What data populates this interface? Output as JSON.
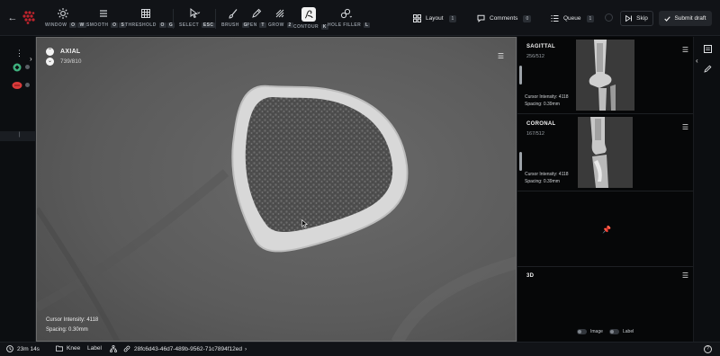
{
  "toolbar": {
    "tools": [
      {
        "name": "window",
        "label": "WINDOW",
        "keys": [
          "O",
          "W"
        ]
      },
      {
        "name": "smooth",
        "label": "SMOOTH",
        "keys": [
          "O",
          "S"
        ]
      },
      {
        "name": "threshold",
        "label": "THRESHOLD",
        "keys": [
          "O",
          "G"
        ]
      },
      {
        "name": "select",
        "label": "SELECT",
        "keys": [
          "ESC"
        ]
      },
      {
        "name": "brush",
        "label": "BRUSH",
        "keys": [
          "G"
        ]
      },
      {
        "name": "pen",
        "label": "PEN",
        "keys": [
          "T"
        ]
      },
      {
        "name": "grow",
        "label": "GROW",
        "keys": [
          "2"
        ]
      },
      {
        "name": "contour",
        "label": "CONTOUR",
        "keys": [
          "K"
        ]
      },
      {
        "name": "hole-filler",
        "label": "HOLE FILLER",
        "keys": [
          "L"
        ]
      }
    ],
    "layout": {
      "label": "Layout",
      "count": "1"
    },
    "comments": {
      "label": "Comments",
      "count": "0"
    },
    "queue": {
      "label": "Queue",
      "count": "1"
    },
    "skip_label": "Skip",
    "submit_label": "Submit draft"
  },
  "axial": {
    "title": "AXIAL",
    "slice": "739/810",
    "cursor_intensity": "Cursor Intensity: 4118",
    "spacing": "Spacing: 0.30mm"
  },
  "sagittal": {
    "title": "SAGITTAL",
    "slice": "256/512",
    "cursor_intensity": "Cursor Intensity: 4118",
    "spacing": "Spacing: 0.39mm"
  },
  "coronal": {
    "title": "CORONAL",
    "slice": "167/512",
    "cursor_intensity": "Cursor Intensity: 4118",
    "spacing": "Spacing: 0.39mm"
  },
  "three_d": {
    "title": "3D",
    "image_toggle": "Image",
    "label_toggle": "Label"
  },
  "bottom": {
    "timer": "23m 14s",
    "body_part": "Knee",
    "label": "Label",
    "series_id": "28fc6d43-46d7-489b-9562-71c7894f12ed"
  },
  "colors": {
    "accent_green": "#3fb27f",
    "accent_red": "#d93a3a",
    "brand_red": "#c0242d"
  }
}
